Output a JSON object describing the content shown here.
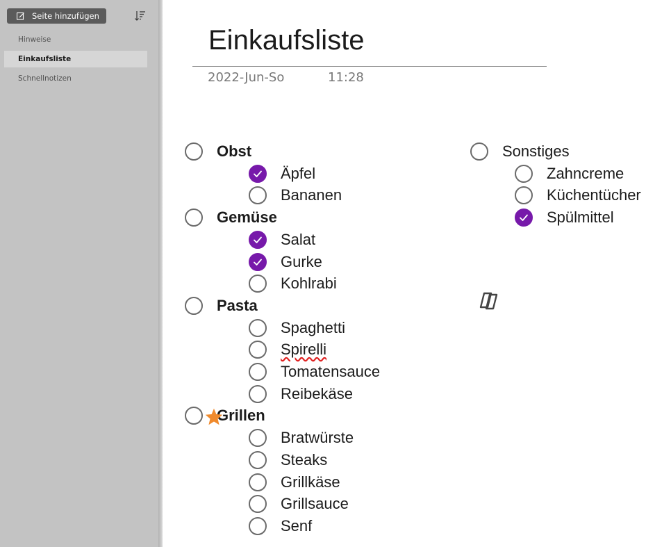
{
  "sidebar": {
    "add_page_label": "Seite hinzufügen",
    "add_page_icon": "add-page-icon",
    "sort_icon": "sort-icon",
    "pages": [
      {
        "label": "Hinweise",
        "active": false
      },
      {
        "label": "Einkaufsliste",
        "active": true
      },
      {
        "label": "Schnellnotizen",
        "active": false
      }
    ]
  },
  "page": {
    "title": "Einkaufsliste",
    "date": "2022-Jun-So",
    "time": "11:28"
  },
  "accent_color": "#7719aa",
  "star_color": "#f08a2c",
  "lists": [
    {
      "heading": "Obst",
      "heading_checked": false,
      "starred": false,
      "items": [
        {
          "label": "Äpfel",
          "checked": true
        },
        {
          "label": "Bananen",
          "checked": false
        }
      ]
    },
    {
      "heading": "Gemüse",
      "heading_checked": false,
      "starred": false,
      "items": [
        {
          "label": "Salat",
          "checked": true
        },
        {
          "label": "Gurke",
          "checked": true
        },
        {
          "label": "Kohlrabi",
          "checked": false
        }
      ]
    },
    {
      "heading": "Pasta",
      "heading_checked": false,
      "starred": false,
      "items": [
        {
          "label": "Spaghetti",
          "checked": false
        },
        {
          "label": "Spirelli",
          "checked": false,
          "misspelled": true
        },
        {
          "label": "Tomatensauce",
          "checked": false
        },
        {
          "label": "Reibekäse",
          "checked": false
        }
      ]
    },
    {
      "heading": "Grillen",
      "heading_checked": false,
      "starred": true,
      "items": [
        {
          "label": "Bratwürste",
          "checked": false
        },
        {
          "label": "Steaks",
          "checked": false
        },
        {
          "label": "Grillkäse",
          "checked": false
        },
        {
          "label": "Grillsauce",
          "checked": false
        },
        {
          "label": "Senf",
          "checked": false
        }
      ]
    },
    {
      "heading": "Sonstiges",
      "heading_checked": false,
      "starred": false,
      "items": [
        {
          "label": "Zahncreme",
          "checked": false
        },
        {
          "label": "Küchentücher",
          "checked": false
        },
        {
          "label": "Spülmittel",
          "checked": true
        }
      ]
    }
  ],
  "copilot_icon": "copilot-icon"
}
